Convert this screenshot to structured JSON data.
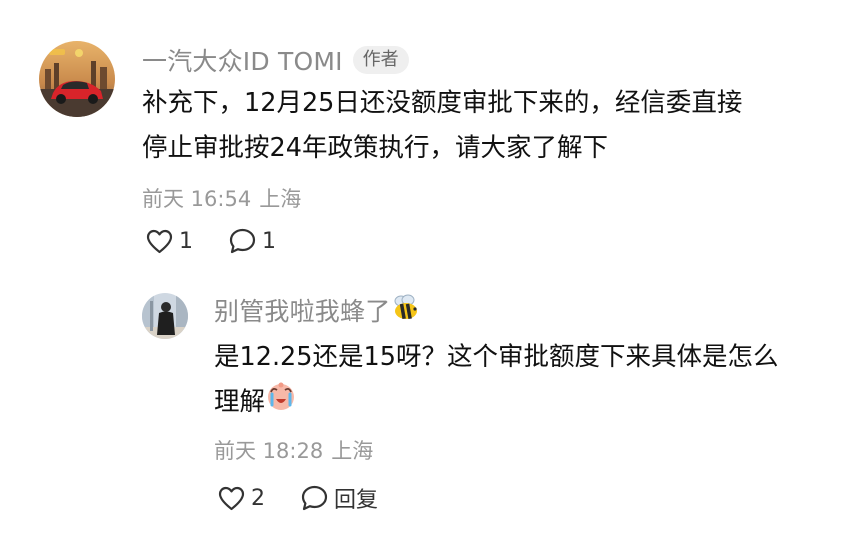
{
  "comments": [
    {
      "user": "一汽大众ID TOMI",
      "tag": "作者",
      "lines": [
        "补充下，12月25日还没额度审批下来的，经信委直接",
        "停止审批按24年政策执行，请大家了解下"
      ],
      "time": "前天 16:54",
      "location": "上海",
      "likes": "1",
      "replies": "1",
      "avatar": "car-photo-avatar"
    },
    {
      "user": "别管我啦我蜂了",
      "user_emoji": "bee-emoji",
      "lines": [
        "是12.25还是15呀？这个审批额度下来具体是怎么",
        "理解"
      ],
      "text_emoji": "crying-face-emoji",
      "time": "前天 18:28",
      "location": "上海",
      "likes": "2",
      "reply_label": "回复",
      "avatar": "person-photo-avatar"
    }
  ],
  "icons": {
    "like": "heart-outline-icon",
    "comment": "speech-bubble-icon"
  }
}
